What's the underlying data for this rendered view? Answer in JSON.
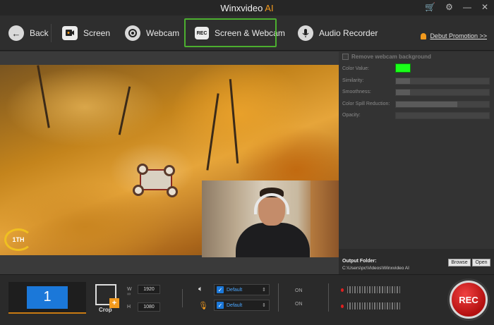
{
  "window": {
    "title_main": "Winxvideo",
    "title_accent": "AI",
    "cart_icon": "cart-icon",
    "settings_icon": "gear-icon",
    "minimize": "—",
    "close": "✕"
  },
  "toolbar": {
    "back": "Back",
    "screen": "Screen",
    "webcam": "Webcam",
    "screen_webcam": "Screen & Webcam",
    "audio_recorder": "Audio Recorder",
    "rec_icon_text": "REC",
    "promo": "Debut Promotion >>"
  },
  "preview": {
    "hud_text": "1TH"
  },
  "panel": {
    "remove_bg": "Remove webcam background",
    "color_value": "Color Value:",
    "color_value_hex": "#1aff1a",
    "similarity": "Similarity:",
    "smoothness": "Smoothness:",
    "color_spill": "Color Spill Reduction:",
    "opacity": "Opacity:",
    "similarity_level": 0.15,
    "smoothness_level": 0.15,
    "color_spill_level": 0.66,
    "opacity_level": 0.0
  },
  "output": {
    "label": "Output Folder:",
    "path": "C:\\Users\\pc\\Videos\\Winxvideo AI",
    "browse": "Browse",
    "open": "Open"
  },
  "bottom": {
    "screen_number": "1",
    "crop_label": "Crop",
    "w_label": "W",
    "h_label": "H",
    "width": "1920",
    "height": "1080",
    "speaker_device": "Default",
    "mic_device": "Default",
    "speaker_state": "ON",
    "mic_state": "ON",
    "rec_label": "REC"
  }
}
